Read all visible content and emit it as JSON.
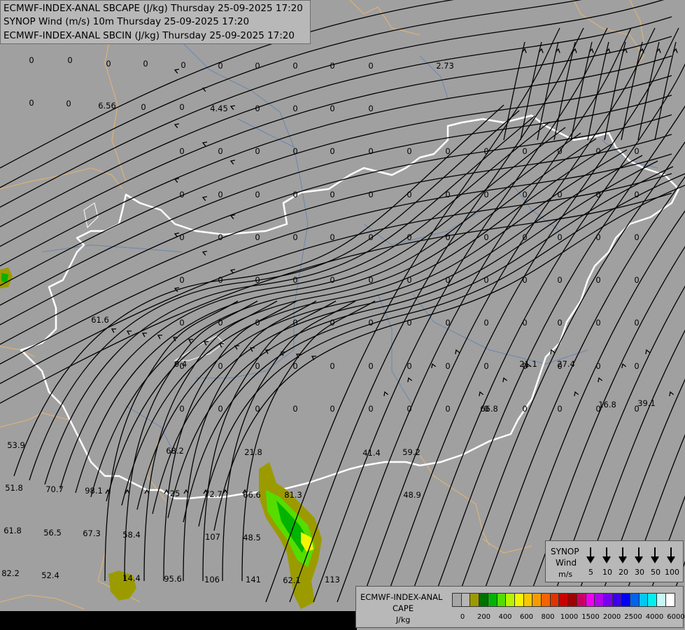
{
  "titles": {
    "line1": "ECMWF-INDEX-ANAL SBCAPE (J/kg) Thursday 25-09-2025 17:20",
    "line2": "SYNOP Wind (m/s) 10m Thursday 25-09-2025 17:20",
    "line3": "ECMWF-INDEX-ANAL SBCIN (J/kg) Thursday 25-09-2025 17:20"
  },
  "wind_legend": {
    "title": "SYNOP",
    "subtitle": "Wind",
    "unit": "m/s",
    "speeds": [
      "5",
      "10",
      "20",
      "30",
      "50",
      "100"
    ]
  },
  "cape_legend": {
    "title": "ECMWF-INDEX-ANAL",
    "subtitle": "CAPE",
    "unit": "J/kg",
    "colors": [
      "#a6a6a6",
      "#b5b5b5",
      "#9b9b00",
      "#007000",
      "#00b400",
      "#55dd00",
      "#b6f500",
      "#f5f500",
      "#f5c800",
      "#f59b00",
      "#f56400",
      "#e13200",
      "#c80000",
      "#a00000",
      "#c80064",
      "#f000f0",
      "#b400f0",
      "#7800f0",
      "#3c00f0",
      "#0000f0",
      "#0064f0",
      "#00c8f0",
      "#00f0f0",
      "#c8f5f5",
      "#ffffff"
    ],
    "ticks": [
      "0",
      "200",
      "400",
      "600",
      "800",
      "1000",
      "1500",
      "2000",
      "2500",
      "4000",
      "6000"
    ]
  },
  "colors": {
    "background": "#a0a0a0",
    "border": "#ffffff",
    "river": "#6c86ae",
    "streamline": "#000000",
    "country_line": "#d8b07a"
  },
  "cape_labels": [
    "0",
    "0",
    "0",
    "0",
    "0",
    "0",
    "0",
    "0",
    "0",
    "0",
    "0",
    "0",
    "0",
    "0",
    "0",
    "0",
    "0",
    "0",
    "2.73",
    "6.56",
    "4.45",
    "61.6",
    "53.9",
    "51.8",
    "70.7",
    "98.1",
    "61.8",
    "56.5",
    "67.3",
    "58.4",
    "82.2",
    "52.4",
    "14.4",
    "95.6",
    "106",
    "141",
    "62.1",
    "113",
    "68.2",
    "21.8",
    "72.7",
    "66.6",
    "81.3",
    "107",
    "48.5",
    "41.4",
    "59.2",
    "48.9",
    "66.8",
    "21.1",
    "27.4",
    "16.8",
    "39.1",
    "0.4",
    "25"
  ]
}
